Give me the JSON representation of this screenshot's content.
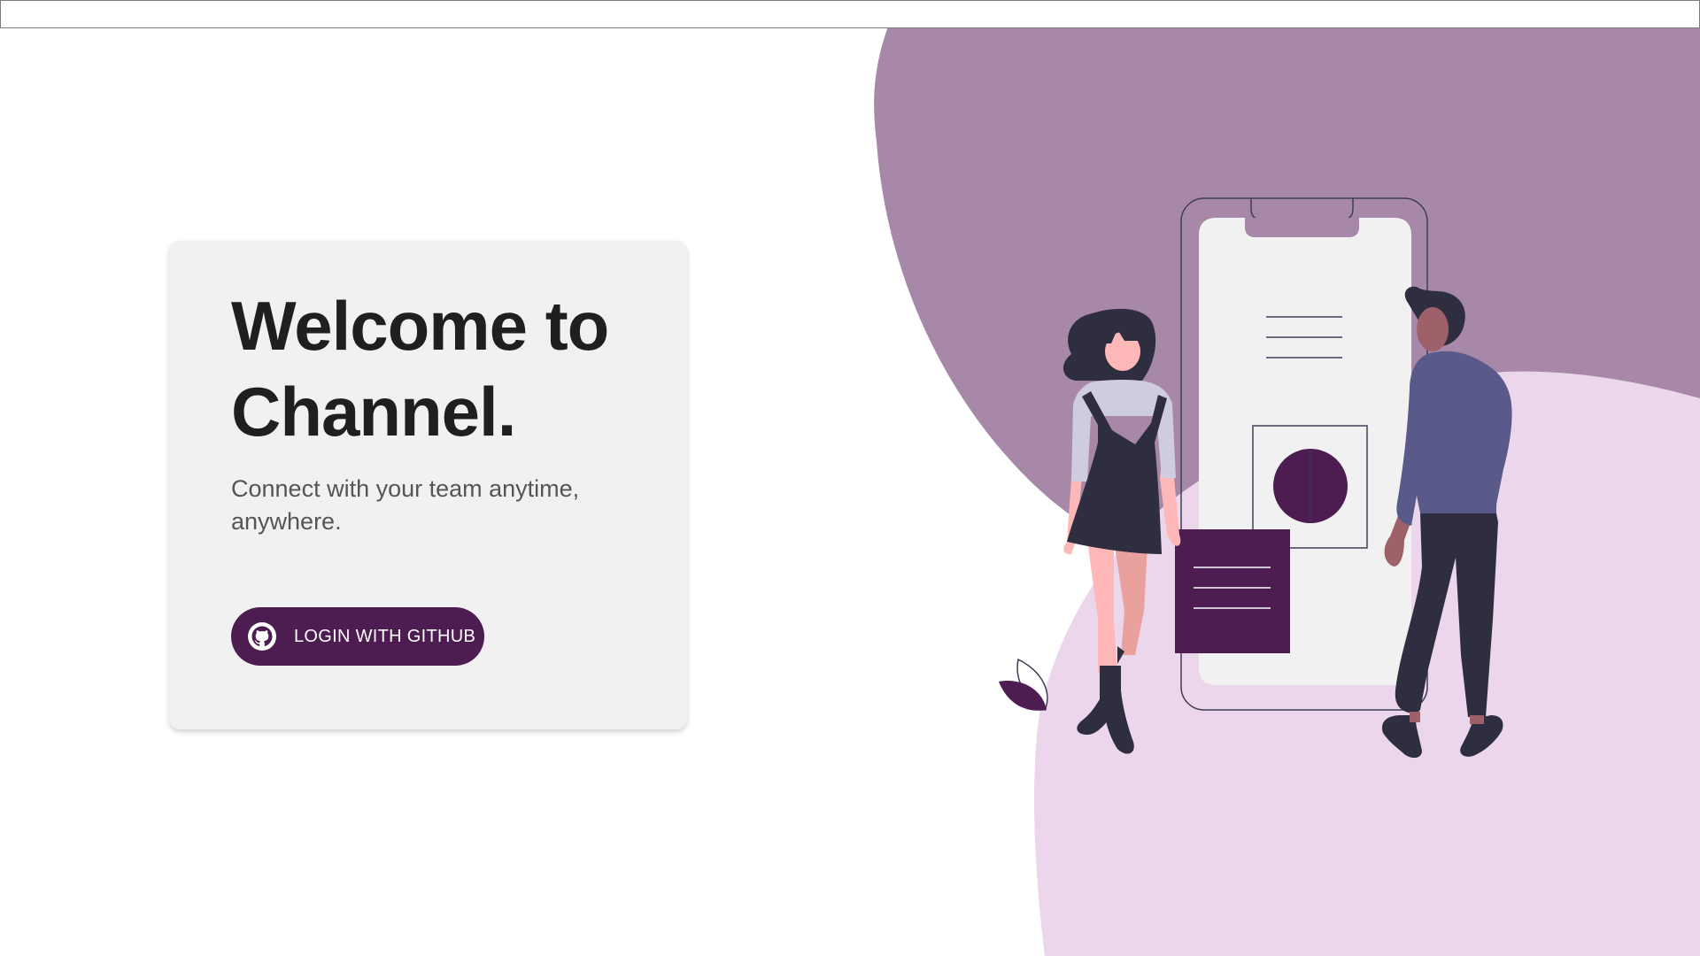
{
  "hero": {
    "title": "Welcome to Channel.",
    "subtitle": "Connect with your team anytime, anywhere."
  },
  "login": {
    "label": "LOGIN WITH GITHUB",
    "icon": "github-icon"
  },
  "illustration": {
    "colors": {
      "blob_dark": "#a888a8",
      "blob_light": "#ebd6eb",
      "accent": "#4d1c50",
      "phone_screen": "#f2f1f2",
      "outline": "#3f3d56"
    }
  }
}
